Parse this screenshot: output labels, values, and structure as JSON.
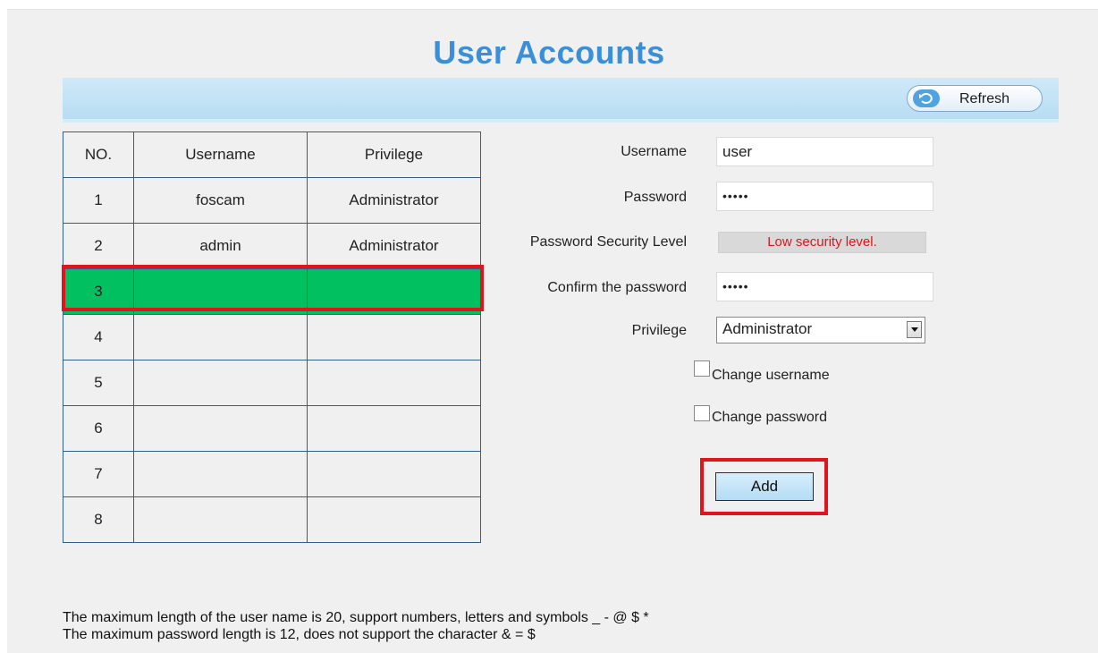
{
  "page": {
    "title": "User Accounts"
  },
  "toolbar": {
    "refresh_label": "Refresh",
    "refresh_icon": "refresh-icon"
  },
  "table": {
    "headers": [
      "NO.",
      "Username",
      "Privilege"
    ],
    "rows": [
      {
        "no": "1",
        "username": "foscam",
        "privilege": "Administrator"
      },
      {
        "no": "2",
        "username": "admin",
        "privilege": "Administrator"
      },
      {
        "no": "3",
        "username": "",
        "privilege": ""
      },
      {
        "no": "4",
        "username": "",
        "privilege": ""
      },
      {
        "no": "5",
        "username": "",
        "privilege": ""
      },
      {
        "no": "6",
        "username": "",
        "privilege": ""
      },
      {
        "no": "7",
        "username": "",
        "privilege": ""
      },
      {
        "no": "8",
        "username": "",
        "privilege": ""
      }
    ],
    "selected_row": "3",
    "selected_color": "#00c060"
  },
  "form": {
    "username_label": "Username",
    "username_value": "user",
    "password_label": "Password",
    "password_value": "•••••",
    "security_label": "Password Security Level",
    "security_value": "Low security level.",
    "confirm_label": "Confirm the password",
    "confirm_value": "•••••",
    "privilege_label": "Privilege",
    "privilege_value": "Administrator",
    "change_username_label": "Change username",
    "change_password_label": "Change password",
    "add_label": "Add"
  },
  "notes": {
    "line1": "The maximum length of the user name is 20, support numbers, letters and symbols _ - @ $ *",
    "line2": "The maximum password length is 12, does not support the character & = $"
  },
  "colors": {
    "title": "#3a8fd8",
    "highlight": "#e0141c",
    "warning_text": "#e0141c",
    "toolbar": "#c4e3f6"
  }
}
